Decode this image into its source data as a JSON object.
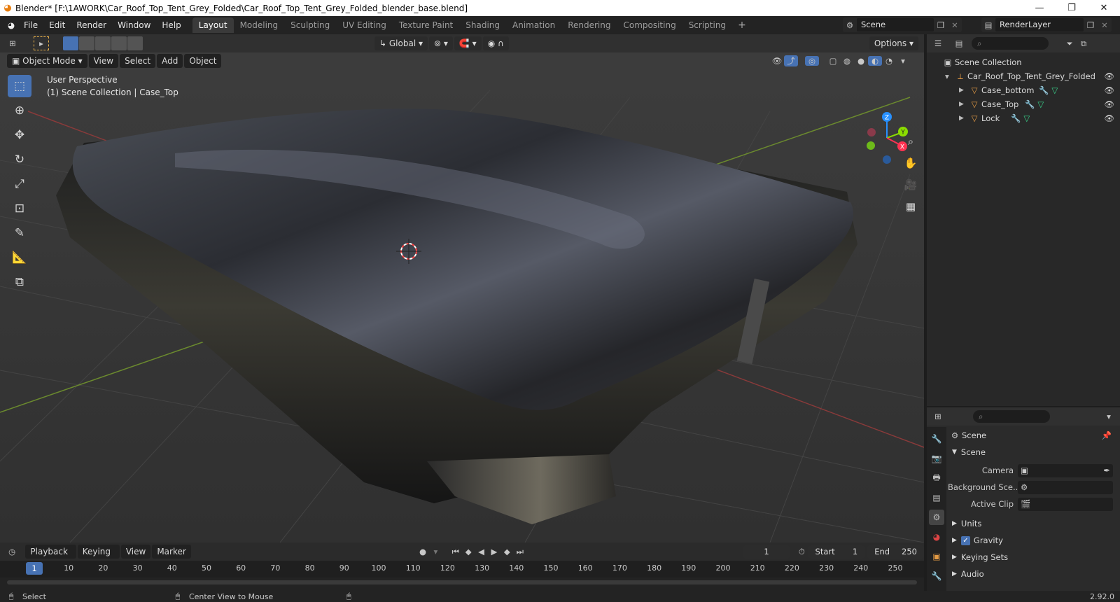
{
  "titlebar": {
    "title": "Blender* [F:\\1AWORK\\Car_Roof_Top_Tent_Grey_Folded\\Car_Roof_Top_Tent_Grey_Folded_blender_base.blend]"
  },
  "menu": [
    "File",
    "Edit",
    "Render",
    "Window",
    "Help"
  ],
  "workspaces": [
    "Layout",
    "Modeling",
    "Sculpting",
    "UV Editing",
    "Texture Paint",
    "Shading",
    "Animation",
    "Rendering",
    "Compositing",
    "Scripting"
  ],
  "scene_name": "Scene",
  "view_layer": "RenderLayer",
  "viewport": {
    "transform_orientation": "Global",
    "options_label": "Options",
    "mode": "Object Mode",
    "header_menu": [
      "View",
      "Select",
      "Add",
      "Object"
    ],
    "perspective_text": "User Perspective",
    "collection_text": "(1) Scene Collection | Case_Top",
    "gizmo_axes": [
      "X",
      "Y",
      "Z"
    ]
  },
  "outliner": {
    "root": "Scene Collection",
    "collection": "Car_Roof_Top_Tent_Grey_Folded",
    "objects": [
      "Case_bottom",
      "Case_Top",
      "Lock"
    ]
  },
  "properties": {
    "context": "Scene",
    "panel_title": "Scene",
    "camera_label": "Camera",
    "background_label": "Background Sce...",
    "active_clip_label": "Active Clip",
    "panels": [
      "Units",
      "Gravity",
      "Keying Sets",
      "Audio"
    ]
  },
  "timeline": {
    "menus": [
      "Playback",
      "Keying",
      "View",
      "Marker"
    ],
    "current_frame": "1",
    "start_label": "Start",
    "start": "1",
    "end_label": "End",
    "end": "250",
    "ticks": [
      "10",
      "20",
      "30",
      "40",
      "50",
      "60",
      "70",
      "80",
      "90",
      "100",
      "110",
      "120",
      "130",
      "140",
      "150",
      "160",
      "170",
      "180",
      "190",
      "200",
      "210",
      "220",
      "230",
      "240",
      "250"
    ]
  },
  "status": {
    "left": "Select",
    "middle": "Center View to Mouse",
    "version": "2.92.0"
  },
  "colors": {
    "accent": "#4772b3",
    "x_axis": "#ff3352",
    "y_axis": "#8bdc00",
    "z_axis": "#2890ff",
    "object_icon": "#e39a44"
  }
}
